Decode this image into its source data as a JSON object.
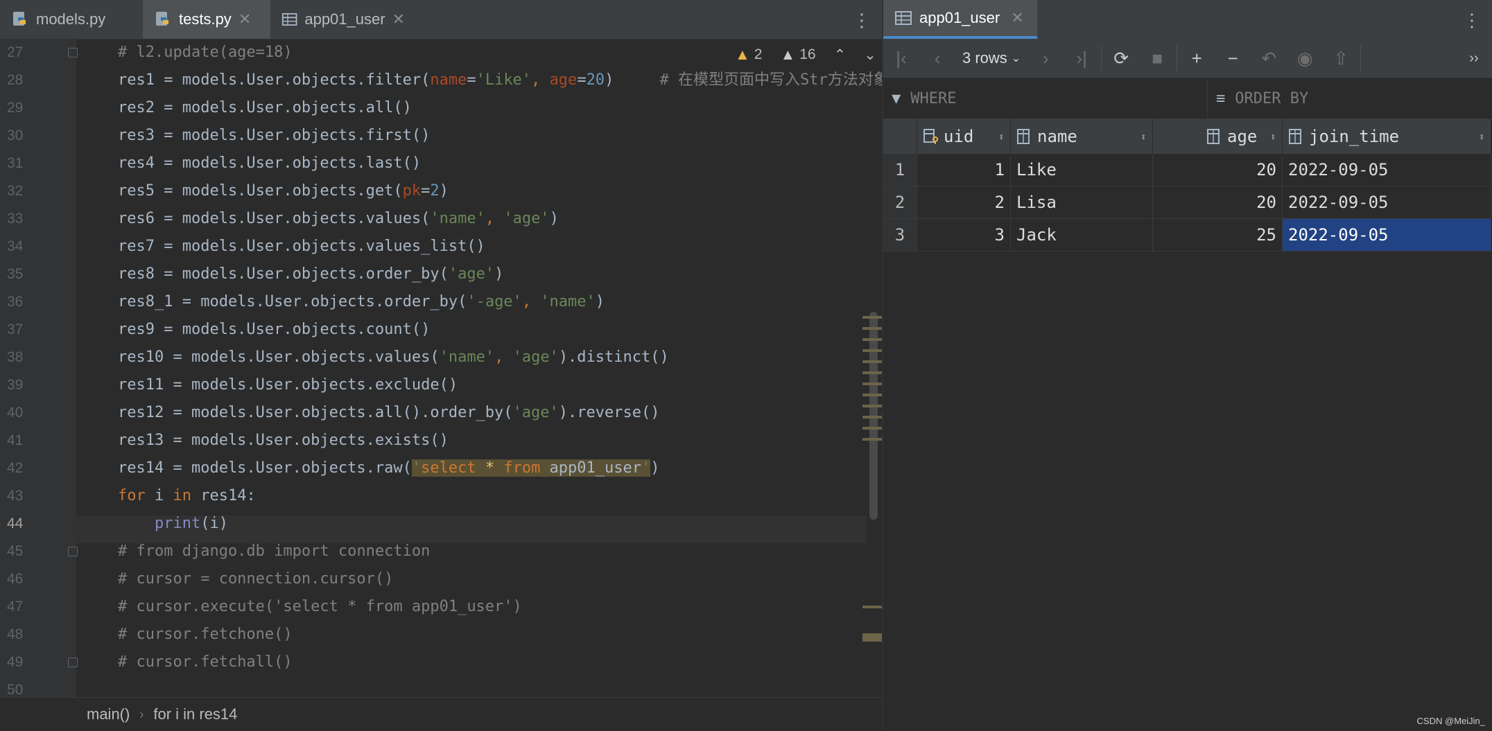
{
  "editor": {
    "tabs": [
      {
        "label": "models.py",
        "icon": "python-file-icon"
      },
      {
        "label": "tests.py",
        "icon": "python-file-icon",
        "active": true
      },
      {
        "label": "app01_user",
        "icon": "table-icon"
      }
    ],
    "inspections": {
      "warnings": "2",
      "weak_warnings": "16"
    },
    "gutter": {
      "line_numbers": [
        "27",
        "28",
        "29",
        "30",
        "31",
        "32",
        "33",
        "34",
        "35",
        "36",
        "37",
        "38",
        "39",
        "40",
        "41",
        "42",
        "43",
        "44",
        "45",
        "46",
        "47",
        "48",
        "49",
        "50"
      ],
      "current_line": "44"
    },
    "code": {
      "l27": "# l2.update(age=18)",
      "l28": {
        "pre": "res1 = models.User.objects.filter(",
        "p1": "name",
        "eq1": "=",
        "s1": "'Like'",
        "comma": ", ",
        "p2": "age",
        "eq2": "=",
        "n1": "20",
        "post": ")",
        "comment": "# 在模型页面中写入Str方法对象"
      },
      "l29": "res2 = models.User.objects.all()",
      "l30": "res3 = models.User.objects.first()",
      "l31": "res4 = models.User.objects.last()",
      "l32": {
        "pre": "res5 = models.User.objects.get(",
        "p1": "pk",
        "eq": "=",
        "n1": "2",
        "post": ")"
      },
      "l33": {
        "pre": "res6 = models.User.objects.values(",
        "s1": "'name'",
        "comma": ", ",
        "s2": "'age'",
        "post": ")"
      },
      "l34": "res7 = models.User.objects.values_list()",
      "l35": {
        "pre": "res8 = models.User.objects.order_by(",
        "s1": "'age'",
        "post": ")"
      },
      "l36": {
        "pre": "res8_1 = models.User.objects.order_by(",
        "s1": "'-age'",
        "comma": ", ",
        "s2": "'name'",
        "post": ")"
      },
      "l37": "res9 = models.User.objects.count()",
      "l38": {
        "pre": "res10 = models.User.objects.values(",
        "s1": "'name'",
        "comma": ", ",
        "s2": "'age'",
        "post": ").distinct()"
      },
      "l39": "res11 = models.User.objects.exclude()",
      "l40": {
        "pre": "res12 = models.User.objects.all().order_by(",
        "s1": "'age'",
        "post": ").reverse()"
      },
      "l41": "res13 = models.User.objects.exists()",
      "l42": {
        "pre": "res14 = models.User.objects.raw(",
        "q1": "'",
        "kw1": "select",
        "star": " * ",
        "kw2": "from",
        "tbl": " app01_user",
        "q2": "'",
        "post": ")"
      },
      "l43": {
        "kw1": "for",
        "mid": " i ",
        "kw2": "in",
        "post": " res14:"
      },
      "l44": {
        "indent": "    ",
        "builtin": "print",
        "post": "(i)"
      },
      "l45": "# from django.db import connection",
      "l46": "# cursor = connection.cursor()",
      "l47": "# cursor.execute('select * from app01_user')",
      "l48": "# cursor.fetchone()",
      "l49": "# cursor.fetchall()"
    },
    "breadcrumb": [
      "main()",
      "for i in res14"
    ]
  },
  "data_editor": {
    "tab": {
      "label": "app01_user",
      "icon": "table-icon"
    },
    "rows_label": "3 rows",
    "where_placeholder": "WHERE",
    "order_by_placeholder": "ORDER BY",
    "columns": [
      {
        "name": "uid",
        "icon": "primary-key-column-icon"
      },
      {
        "name": "name",
        "icon": "column-icon"
      },
      {
        "name": "age",
        "icon": "column-icon"
      },
      {
        "name": "join_time",
        "icon": "column-icon"
      }
    ],
    "rows": [
      {
        "n": "1",
        "uid": "1",
        "name": "Like",
        "age": "20",
        "join_time": "2022-09-05"
      },
      {
        "n": "2",
        "uid": "2",
        "name": "Lisa",
        "age": "20",
        "join_time": "2022-09-05"
      },
      {
        "n": "3",
        "uid": "3",
        "name": "Jack",
        "age": "25",
        "join_time": "2022-09-05"
      }
    ]
  },
  "watermark": "CSDN @MeiJin_"
}
